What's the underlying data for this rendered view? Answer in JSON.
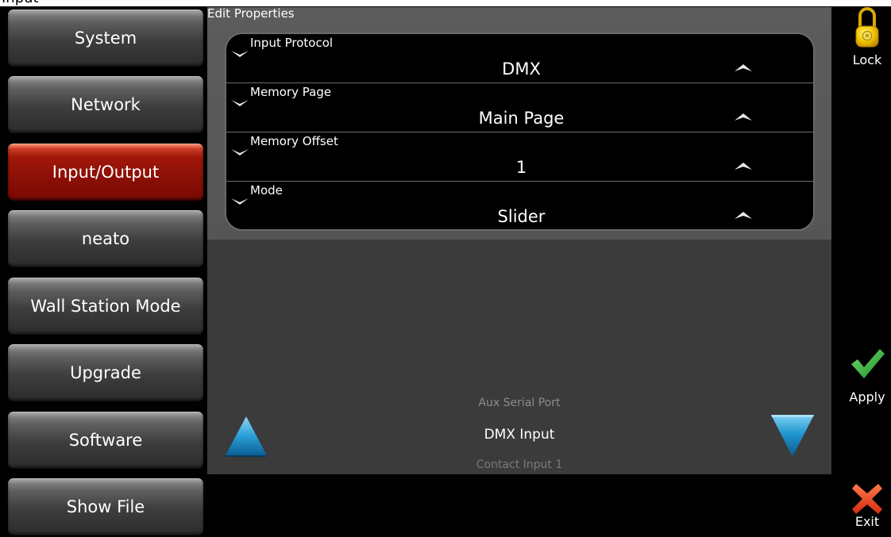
{
  "window": {
    "title_fragment": "Input"
  },
  "sidebar": {
    "items": [
      {
        "label": "System"
      },
      {
        "label": "Network"
      },
      {
        "label": "Input/Output"
      },
      {
        "label": "neato"
      },
      {
        "label": "Wall Station Mode"
      },
      {
        "label": "Upgrade"
      },
      {
        "label": "Software"
      },
      {
        "label": "Show File"
      }
    ],
    "active": "Input/Output"
  },
  "panel": {
    "title": "Edit Properties",
    "properties": [
      {
        "label": "Input Protocol",
        "value": "DMX"
      },
      {
        "label": "Memory Page",
        "value": "Main Page"
      },
      {
        "label": "Memory Offset",
        "value": "1"
      },
      {
        "label": "Mode",
        "value": "Slider"
      }
    ],
    "port_selector": {
      "previous": "Aux Serial Port",
      "current": "DMX Input",
      "next": "Contact Input 1"
    }
  },
  "actions": {
    "lock": {
      "label": "Lock",
      "icon": "padlock-icon",
      "color": "#f5c400"
    },
    "apply": {
      "label": "Apply",
      "icon": "checkmark-icon",
      "color": "#2ea42e"
    },
    "exit": {
      "label": "Exit",
      "icon": "x-icon",
      "color": "#e64a1e"
    }
  },
  "colors": {
    "accent_active": "#9b1408",
    "arrow_blue": "#1e8fc8"
  }
}
